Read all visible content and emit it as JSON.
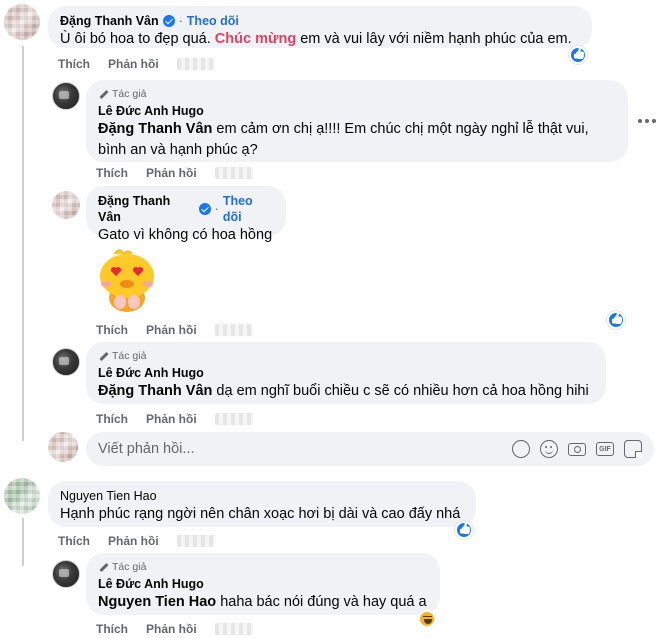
{
  "comments": [
    {
      "author": "Đặng Thanh Vân",
      "follow": "Theo dõi",
      "text_before": "Ù ôi bó hoa to đẹp quá. ",
      "text_highlight": "Chúc mừng",
      "text_after": " em và vui lây với niềm hạnh phúc của em.",
      "reaction": "like-icon"
    },
    {
      "badge": "Tác giả",
      "author": "Lê Đức Anh Hugo",
      "tag": "Đặng Thanh Vân",
      "text_line1": " em cảm ơn chị ạ!!!! Em chúc chị một ngày nghỉ lễ thật vui,",
      "text_line2": "bình an và hạnh phúc ạ?"
    },
    {
      "author": "Đặng Thanh Vân",
      "follow": "Theo dõi",
      "text": "Gato vì không có hoa hồng",
      "sticker": "heart-eyes-duck-sticker",
      "reaction": "like-icon"
    },
    {
      "badge": "Tác giả",
      "author": "Lê Đức Anh Hugo",
      "tag": "Đặng Thanh Vân",
      "text": " dạ em nghĩ buổi chiều c sẽ có nhiều hơn cả hoa hồng hihi"
    },
    {
      "author": "Nguyen Tien Hao",
      "text": "Hạnh phúc rạng ngời nên chân xoạc hơi bị dài và cao đấy nhá",
      "reaction": "like-icon"
    },
    {
      "badge": "Tác giả",
      "author": "Lê Đức Anh Hugo",
      "tag": "Nguyen Tien Hao",
      "text": " haha bác nói đúng và hay quá a",
      "reaction": "haha-icon"
    }
  ],
  "actions": {
    "like": "Thích",
    "reply": "Phản hồi"
  },
  "reply_box": {
    "placeholder": "Viết phản hồi..."
  },
  "colors": {
    "link": "#216fdb",
    "highlight": "#e4405f",
    "bubble": "#f0f2f5",
    "meta": "#65676b"
  }
}
